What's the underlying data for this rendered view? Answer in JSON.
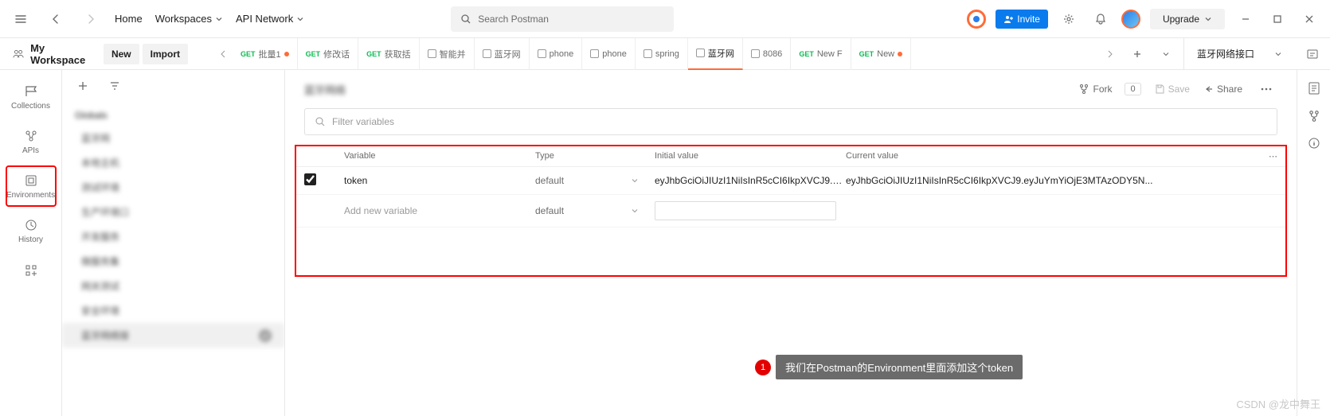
{
  "topnav": {
    "home": "Home",
    "workspaces": "Workspaces",
    "api_network": "API Network",
    "search_placeholder": "Search Postman",
    "invite": "Invite",
    "upgrade": "Upgrade"
  },
  "workspace": {
    "name": "My Workspace",
    "new": "New",
    "import": "Import"
  },
  "rail": {
    "collections": "Collections",
    "apis": "APIs",
    "environments": "Environments",
    "history": "History"
  },
  "sidebar": {
    "header": "Globals",
    "items": [
      "蓝牙网",
      "本地主机",
      "测试环境",
      "生产环境口",
      "开发服务",
      "微服务集",
      "网关测试",
      "安全环境",
      "蓝牙网络接"
    ],
    "selected_index": 8
  },
  "tabs": [
    {
      "method": "GET",
      "label": "批量1",
      "dot": true,
      "icon": ""
    },
    {
      "method": "GET",
      "label": "修改话",
      "dot": false,
      "icon": ""
    },
    {
      "method": "GET",
      "label": "获取括",
      "dot": false,
      "icon": ""
    },
    {
      "method": "",
      "label": "智能并",
      "dot": false,
      "icon": "sq"
    },
    {
      "method": "",
      "label": "蓝牙网",
      "dot": false,
      "icon": "sq"
    },
    {
      "method": "",
      "label": "phone",
      "dot": false,
      "icon": "sq"
    },
    {
      "method": "",
      "label": "phone",
      "dot": false,
      "icon": "sq"
    },
    {
      "method": "",
      "label": "spring",
      "dot": false,
      "icon": "sq"
    },
    {
      "method": "",
      "label": "蓝牙网",
      "dot": false,
      "icon": "sq",
      "active": true
    },
    {
      "method": "",
      "label": "8086",
      "dot": false,
      "icon": "sq"
    },
    {
      "method": "GET",
      "label": "New F",
      "dot": false,
      "icon": ""
    },
    {
      "method": "GET",
      "label": "New",
      "dot": true,
      "icon": ""
    }
  ],
  "env_selector": "蓝牙网络接口",
  "content": {
    "title": "蓝牙网络",
    "fork": "Fork",
    "fork_count": "0",
    "save": "Save",
    "share": "Share",
    "filter_placeholder": "Filter variables",
    "headers": {
      "variable": "Variable",
      "type": "Type",
      "initial": "Initial value",
      "current": "Current value"
    },
    "rows": [
      {
        "checked": true,
        "variable": "token",
        "type": "default",
        "initial": "eyJhbGciOiJIUzI1NiIsInR5cCI6IkpXVCJ9.e...",
        "current": "eyJhbGciOiJIUzI1NiIsInR5cCI6IkpXVCJ9.eyJuYmYiOjE3MTAzODY5N..."
      }
    ],
    "add_placeholder": "Add new variable",
    "add_type": "default"
  },
  "annotation": {
    "num": "1",
    "text": "我们在Postman的Environment里面添加这个token"
  },
  "watermark": "CSDN @龙中舞王"
}
